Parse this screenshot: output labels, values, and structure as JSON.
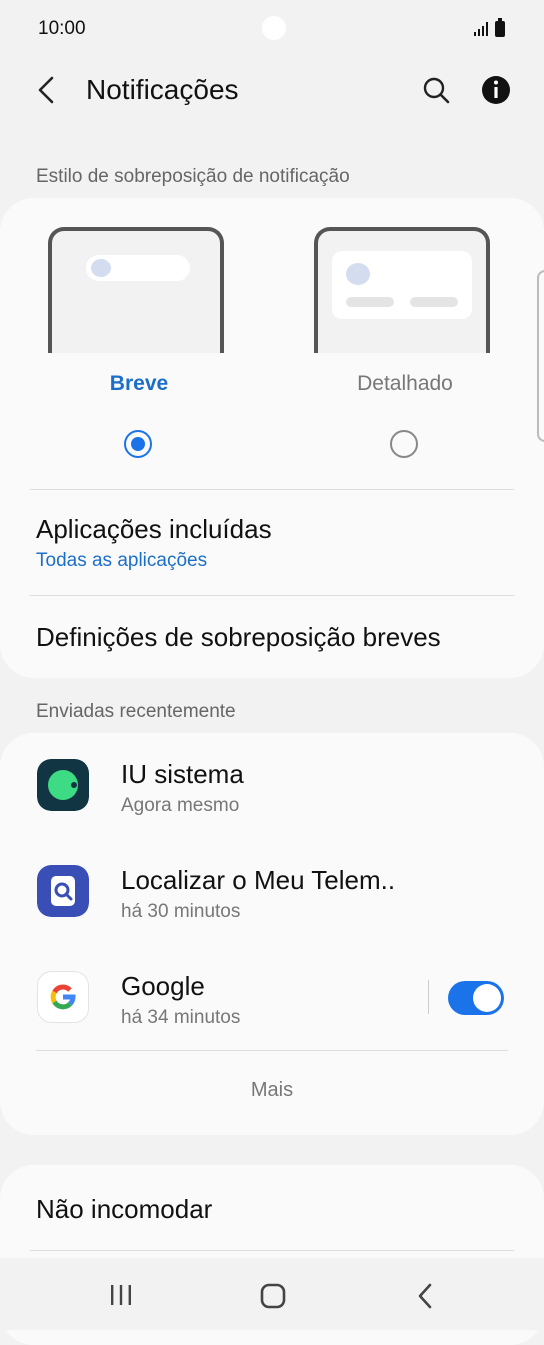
{
  "status_bar": {
    "time": "10:00"
  },
  "header": {
    "title": "Notificações"
  },
  "sections": {
    "overlay_style": "Estilo de sobreposição de notificação",
    "recent": "Enviadas recentemente"
  },
  "overlay": {
    "options": [
      {
        "label": "Breve",
        "selected": true
      },
      {
        "label": "Detalhado",
        "selected": false
      }
    ]
  },
  "included_apps": {
    "title": "Aplicações incluídas",
    "value": "Todas as aplicações"
  },
  "brief_settings": {
    "title": "Definições de sobreposição breves"
  },
  "recent_apps": [
    {
      "name": "IU sistema",
      "time": "Agora mesmo"
    },
    {
      "name": "Localizar o Meu Telem..",
      "time": "há 30 minutos"
    },
    {
      "name": "Google",
      "time": "há 34 minutos",
      "enabled": true
    }
  ],
  "more_label": "Mais",
  "dnd": {
    "title": "Não incomodar"
  },
  "colors": {
    "accent": "#1a73e8",
    "link": "#1c6fc9"
  }
}
